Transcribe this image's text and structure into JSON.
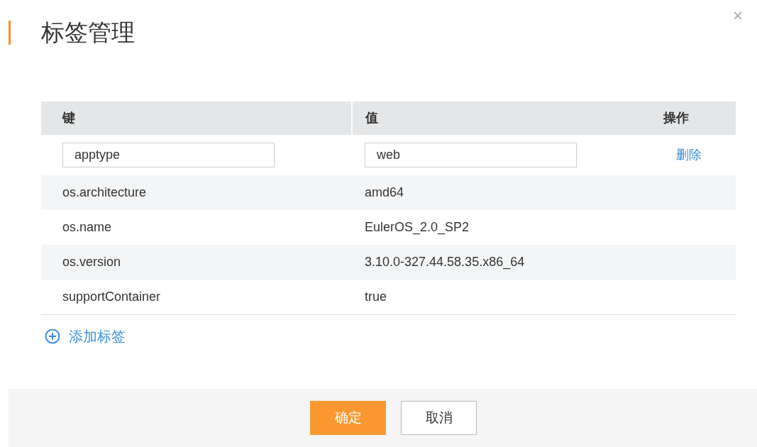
{
  "dialog": {
    "title": "标签管理",
    "close": "×"
  },
  "table": {
    "columns": [
      "键",
      "值",
      "操作"
    ],
    "rows": [
      {
        "kind": "input",
        "key": "apptype",
        "value": "web",
        "action": "删除"
      },
      {
        "kind": "static",
        "key": "os.architecture",
        "value": "amd64"
      },
      {
        "kind": "static",
        "key": "os.name",
        "value": "EulerOS_2.0_SP2"
      },
      {
        "kind": "static",
        "key": "os.version",
        "value": "3.10.0-327.44.58.35.x86_64"
      },
      {
        "kind": "static",
        "key": "supportContainer",
        "value": "true"
      }
    ]
  },
  "add_tag": "添加标签",
  "buttons": [
    {
      "label": "确定",
      "kind": "primary"
    },
    {
      "label": "取消",
      "kind": "secondary"
    }
  ]
}
